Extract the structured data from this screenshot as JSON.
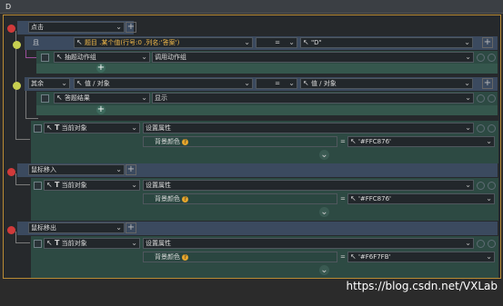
{
  "window": {
    "title": "D"
  },
  "rows": {
    "click": {
      "label": "点击"
    },
    "and_row": {
      "logic": "且",
      "condition": "题目 .某个值(行号:0 ,列名:'答案')",
      "operator": "=",
      "value": "\"D\""
    },
    "and_action": {
      "target": "抽题动作组",
      "action": "调用动作组"
    },
    "else_row": {
      "logic": "其余",
      "left": "值 / 对象",
      "operator": "=",
      "right": "值 / 对象"
    },
    "else_action": {
      "target": "答题结果",
      "action": "显示"
    },
    "set1": {
      "target": "当前对象",
      "action": "设置属性",
      "prop": "背景颜色",
      "op": "=",
      "value": "'#FFC876'"
    },
    "mouse_in": {
      "label": "鼠标移入"
    },
    "set2": {
      "target": "当前对象",
      "action": "设置属性",
      "prop": "背景颜色",
      "op": "=",
      "value": "'#FFC876'"
    },
    "mouse_out": {
      "label": "鼠标移出"
    },
    "set3": {
      "target": "当前对象",
      "action": "设置属性",
      "prop": "背景颜色",
      "op": "=",
      "value": "'#F6F7FB'"
    }
  },
  "icons": {
    "pointer": "↖",
    "text": "T",
    "plus": "+",
    "chevron": "⌄",
    "help": "?"
  },
  "watermark": "https://blog.csdn.net/VXLab",
  "colors": {
    "event_bar": "#3b4a5f",
    "logic_bar": "#35574d",
    "action_bar": "#2d4a43",
    "remove": "#d03a3a",
    "highlight": "#f0b84a",
    "frame_border": "#b88a34"
  }
}
